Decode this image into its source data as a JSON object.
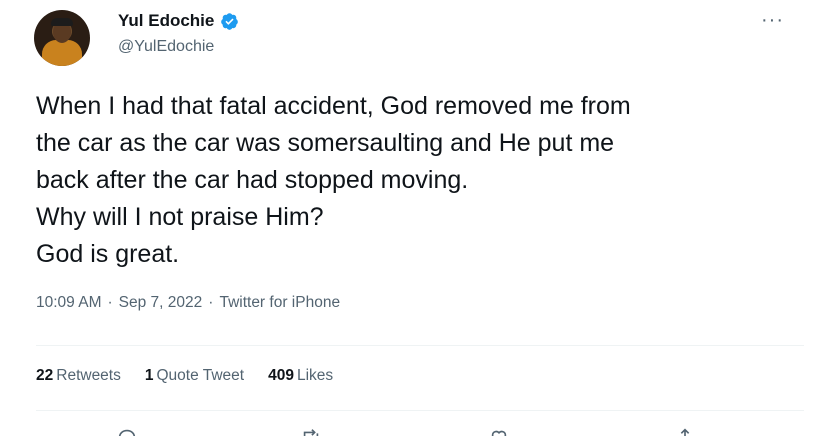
{
  "author": {
    "display_name": "Yul Edochie",
    "handle": "@YulEdochie"
  },
  "tweet": {
    "text": "When I had that fatal accident, God removed me from\nthe car as the car was somersaulting and He put me\nback after the car had stopped moving.\nWhy will I not praise Him?\nGod is great.",
    "time": "10:09 AM",
    "date": "Sep 7, 2022",
    "source": "Twitter for iPhone",
    "separator": "·"
  },
  "stats": {
    "retweets_count": "22",
    "retweets_label": "Retweets",
    "quotes_count": "1",
    "quotes_label": "Quote Tweet",
    "likes_count": "409",
    "likes_label": "Likes"
  },
  "more_label": "···",
  "colors": {
    "text_primary": "#0f1419",
    "text_secondary": "#536471",
    "verified_blue": "#1d9bf0",
    "divider": "#eff3f4"
  },
  "icons": [
    "verified-badge-icon",
    "more-icon",
    "reply-icon",
    "retweet-icon",
    "like-icon",
    "share-icon"
  ]
}
